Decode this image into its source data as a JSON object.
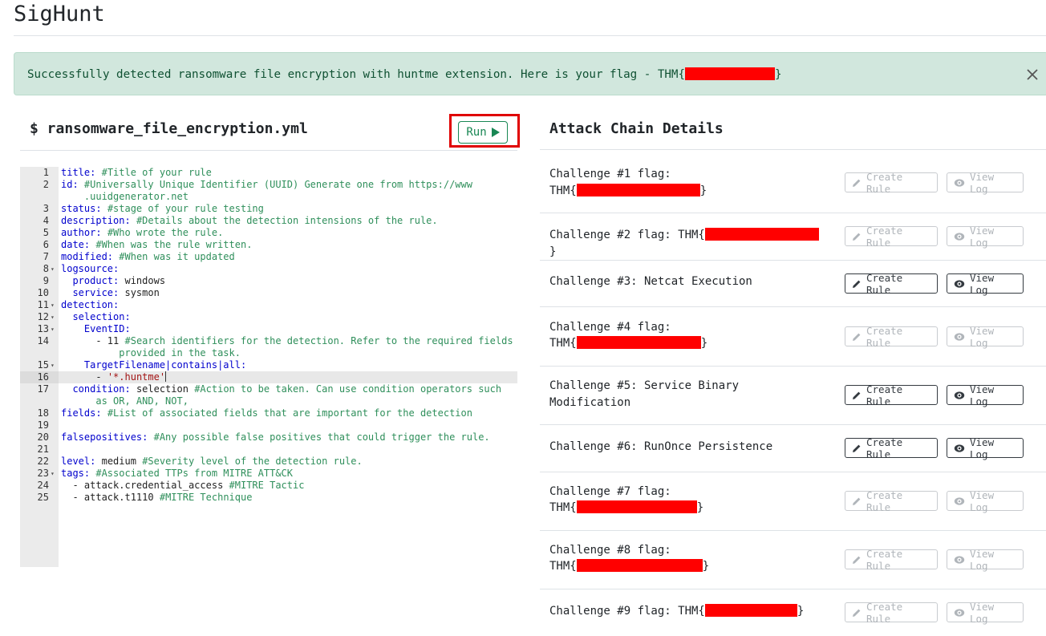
{
  "app": {
    "title": "SigHunt"
  },
  "alert": {
    "message": "Successfully detected ransomware file encryption with huntme extension. Here is your flag - THM{",
    "suffix": "}"
  },
  "editor": {
    "file_name": "$ ransomware_file_encryption.yml",
    "run_label": "Run",
    "lines": [
      {
        "n": "1",
        "fold": false,
        "html": "<span class='k'>title:</span> <span class='c'>#Title of your rule</span>"
      },
      {
        "n": "2",
        "fold": false,
        "html": "<span class='k'>id:</span> <span class='c'>#Universally Unique Identifier (UUID) Generate one from https://www</span>"
      },
      {
        "n": "",
        "fold": false,
        "html": "<span class='c'>    .uuidgenerator.net</span>"
      },
      {
        "n": "3",
        "fold": false,
        "html": "<span class='k'>status:</span> <span class='c'>#stage of your rule testing</span>"
      },
      {
        "n": "4",
        "fold": false,
        "html": "<span class='k'>description:</span> <span class='c'>#Details about the detection intensions of the rule.</span>"
      },
      {
        "n": "5",
        "fold": false,
        "html": "<span class='k'>author:</span> <span class='c'>#Who wrote the rule.</span>"
      },
      {
        "n": "6",
        "fold": false,
        "html": "<span class='k'>date:</span> <span class='c'>#When was the rule written.</span>"
      },
      {
        "n": "7",
        "fold": false,
        "html": "<span class='k'>modified:</span> <span class='c'>#When was it updated</span>"
      },
      {
        "n": "8",
        "fold": true,
        "html": "<span class='k'>logsource:</span>"
      },
      {
        "n": "9",
        "fold": false,
        "html": "  <span class='k'>product:</span> <span class='v'>windows</span>"
      },
      {
        "n": "10",
        "fold": false,
        "html": "  <span class='k'>service:</span> <span class='v'>sysmon</span>"
      },
      {
        "n": "11",
        "fold": true,
        "html": "<span class='k'>detection:</span>"
      },
      {
        "n": "12",
        "fold": true,
        "html": "  <span class='k'>selection:</span>"
      },
      {
        "n": "13",
        "fold": true,
        "html": "    <span class='k'>EventID:</span>"
      },
      {
        "n": "14",
        "fold": false,
        "html": "      <span class='v'>- 11</span> <span class='c'>#Search identifiers for the detection. Refer to the required fields</span>"
      },
      {
        "n": "",
        "fold": false,
        "html": "<span class='c'>          provided in the task.</span>"
      },
      {
        "n": "15",
        "fold": true,
        "html": "    <span class='k'>TargetFilename|contains|all:</span>"
      },
      {
        "n": "16",
        "fold": false,
        "active": true,
        "html": "      <span class='v'>-</span> <span class='s'>'*.huntme'</span><span class='cursor'></span>"
      },
      {
        "n": "17",
        "fold": false,
        "html": "  <span class='k'>condition:</span> <span class='v'>selection</span> <span class='c'>#Action to be taken. Can use condition operators such</span>"
      },
      {
        "n": "",
        "fold": false,
        "html": "<span class='c'>      as OR, AND, NOT,</span>"
      },
      {
        "n": "18",
        "fold": false,
        "html": "<span class='k'>fields:</span> <span class='c'>#List of associated fields that are important for the detection</span>"
      },
      {
        "n": "19",
        "fold": false,
        "html": ""
      },
      {
        "n": "20",
        "fold": false,
        "html": "<span class='k'>falsepositives:</span> <span class='c'>#Any possible false positives that could trigger the rule.</span>"
      },
      {
        "n": "21",
        "fold": false,
        "html": ""
      },
      {
        "n": "22",
        "fold": false,
        "html": "<span class='k'>level:</span> <span class='v'>medium</span> <span class='c'>#Severity level of the detection rule.</span>"
      },
      {
        "n": "23",
        "fold": true,
        "html": "<span class='k'>tags:</span> <span class='c'>#Associated TTPs from MITRE ATT&amp;CK</span>"
      },
      {
        "n": "24",
        "fold": false,
        "html": "  <span class='v'>- attack.credential_access</span> <span class='c'>#MITRE Tactic</span>"
      },
      {
        "n": "25",
        "fold": false,
        "html": "  <span class='v'>- attack.t1110</span> <span class='c'>#MITRE Technique</span>"
      }
    ]
  },
  "attack_chain": {
    "title": "Attack Chain Details",
    "create_label": "Create Rule",
    "view_label": "View Log",
    "challenges": [
      {
        "line1": "Challenge #1 flag:",
        "line2": "THM{",
        "end": "}",
        "redact": true,
        "enabled": false
      },
      {
        "line1": "Challenge #2 flag: THM{",
        "line2": "",
        "end": "}",
        "redact": true,
        "enabled": false
      },
      {
        "line1": "Challenge #3: Netcat Execution",
        "line2": "",
        "end": "",
        "redact": false,
        "enabled": true
      },
      {
        "line1": "Challenge #4 flag:",
        "line2": "THM{",
        "end": "}",
        "redact": true,
        "enabled": false
      },
      {
        "line1": "Challenge #5: Service Binary",
        "line2": "Modification",
        "end": "",
        "redact": false,
        "enabled": true
      },
      {
        "line1": "Challenge #6: RunOnce Persistence",
        "line2": "",
        "end": "",
        "redact": false,
        "enabled": true
      },
      {
        "line1": "Challenge #7 flag:",
        "line2": "THM{",
        "end": "}",
        "redact": true,
        "enabled": false
      },
      {
        "line1": "Challenge #8 flag:",
        "line2": "THM{",
        "end": "}",
        "redact": true,
        "enabled": false
      },
      {
        "line1": "Challenge #9 flag: THM{",
        "line2": "",
        "end": "}",
        "redact": true,
        "enabled": false
      }
    ]
  },
  "colors": {
    "alert_bg": "#d1e7dd",
    "alert_text": "#0f5132",
    "run_green": "#198754",
    "highlight_red": "#e00000"
  }
}
